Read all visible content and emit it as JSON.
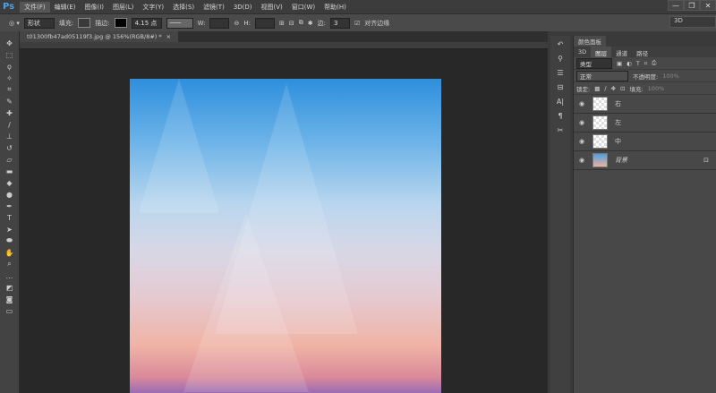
{
  "app": {
    "logo": "Ps",
    "window_buttons": [
      "—",
      "❐",
      "✕"
    ]
  },
  "menu": [
    "文件(F)",
    "编辑(E)",
    "图像(I)",
    "图层(L)",
    "文字(Y)",
    "选择(S)",
    "滤镜(T)",
    "3D(D)",
    "视图(V)",
    "窗口(W)",
    "帮助(H)"
  ],
  "options": {
    "shape_mode": "形状",
    "fill_label": "填充:",
    "stroke_label": "描边:",
    "stroke_width": "4.15 点",
    "w_label": "W:",
    "h_label": "H:",
    "radius_label": "边:",
    "radius_value": "3",
    "align_edges_label": "对齐边缘",
    "workspace": "3D"
  },
  "document": {
    "tab_label": "t01300fb47ad05119f3.jpg @ 156%(RGB/8#) *",
    "close": "×"
  },
  "panel": {
    "title": "颜色面板",
    "tabs": [
      "3D",
      "图层",
      "通道",
      "路径"
    ],
    "filter_kind": "类型",
    "blend_mode": "正常",
    "opacity_label": "不透明度:",
    "opacity": "100%",
    "lock_label": "锁定:",
    "fill_label": "填充:",
    "fill": "100%"
  },
  "layers": [
    {
      "name": "右"
    },
    {
      "name": "左"
    },
    {
      "name": "中"
    },
    {
      "name": "背景",
      "locked": true
    }
  ]
}
